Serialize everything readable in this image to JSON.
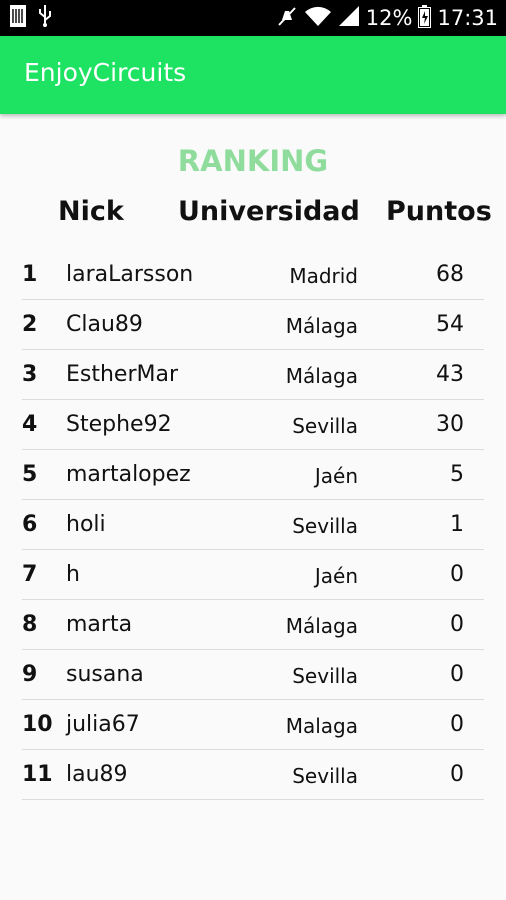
{
  "status_bar": {
    "battery_percent": "12%",
    "time": "17:31",
    "icons": [
      "sim-icon",
      "usb-icon",
      "mute-icon",
      "wifi-icon",
      "signal-icon",
      "battery-icon"
    ]
  },
  "app": {
    "title": "EnjoyCircuits",
    "accent_color": "#1ee362"
  },
  "ranking": {
    "heading": "RANKING",
    "heading_color": "#8fdc9c",
    "columns": {
      "nick": "Nick",
      "university": "Universidad",
      "points": "Puntos"
    },
    "rows": [
      {
        "rank": "1",
        "nick": "laraLarsson",
        "university": "Madrid",
        "points": "68"
      },
      {
        "rank": "2",
        "nick": "Clau89",
        "university": "Málaga",
        "points": "54"
      },
      {
        "rank": "3",
        "nick": "EstherMar",
        "university": "Málaga",
        "points": "43"
      },
      {
        "rank": "4",
        "nick": "Stephe92",
        "university": "Sevilla",
        "points": "30"
      },
      {
        "rank": "5",
        "nick": "martalopez",
        "university": "Jaén",
        "points": "5"
      },
      {
        "rank": "6",
        "nick": "holi",
        "university": "Sevilla",
        "points": "1"
      },
      {
        "rank": "7",
        "nick": "h",
        "university": "Jaén",
        "points": "0"
      },
      {
        "rank": "8",
        "nick": "marta",
        "university": "Málaga",
        "points": "0"
      },
      {
        "rank": "9",
        "nick": "susana",
        "university": "Sevilla",
        "points": "0"
      },
      {
        "rank": "10",
        "nick": "julia67",
        "university": "Malaga",
        "points": "0"
      },
      {
        "rank": "11",
        "nick": "lau89",
        "university": "Sevilla",
        "points": "0"
      }
    ]
  }
}
